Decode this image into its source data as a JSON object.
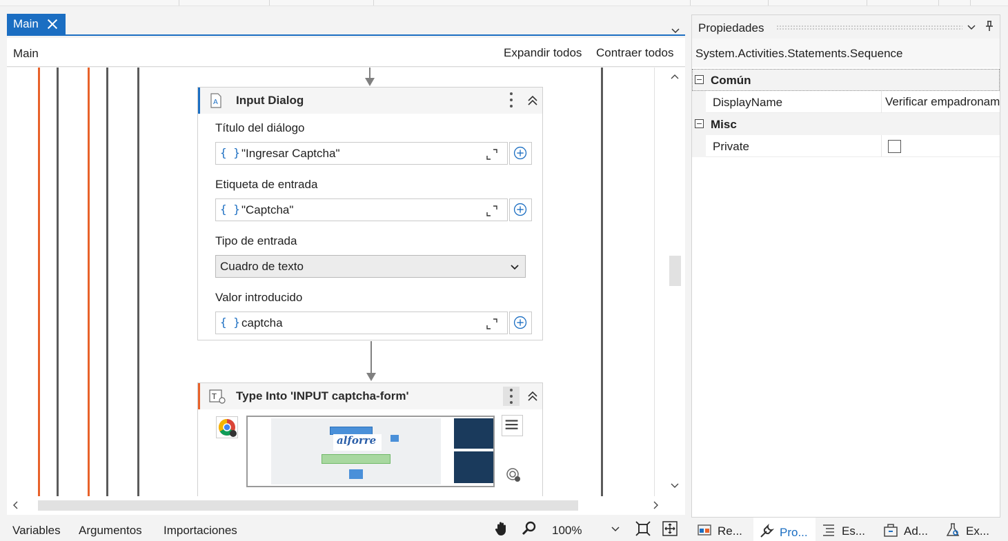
{
  "tab": {
    "title": "Main"
  },
  "breadcrumb": {
    "path": "Main",
    "expand_all": "Expandir todos",
    "collapse_all": "Contraer todos"
  },
  "input_dialog": {
    "title": "Input Dialog",
    "fields": [
      {
        "label": "Título del diálogo",
        "value": "\"Ingresar Captcha\""
      },
      {
        "label": "Etiqueta de entrada",
        "value": "\"Captcha\""
      },
      {
        "label": "Tipo de entrada",
        "value": "Cuadro de texto"
      },
      {
        "label": "Valor introducido",
        "value": "captcha"
      }
    ],
    "brace_glyph": "{ }"
  },
  "type_into": {
    "title": "Type Into 'INPUT captcha-form'",
    "thumb_text": "alforre"
  },
  "bottom": {
    "variables": "Variables",
    "arguments": "Argumentos",
    "imports": "Importaciones",
    "zoom": "100%"
  },
  "properties": {
    "title": "Propiedades",
    "type_name": "System.Activities.Statements.Sequence",
    "categories": [
      {
        "label": "Común",
        "props": [
          {
            "name": "DisplayName",
            "value": "Verificar empadronam"
          }
        ]
      },
      {
        "label": "Misc",
        "props": [
          {
            "name": "Private",
            "value": ""
          }
        ]
      }
    ]
  },
  "panel_tabs": [
    "Re...",
    "Pro...",
    "Es...",
    "Ad...",
    "Ex..."
  ],
  "colors": {
    "accent": "#1b6ec2",
    "orange": "#e8622a",
    "gray_line": "#5a5a5a"
  },
  "icons": [
    "close-icon",
    "chevron-down-icon",
    "text-input-icon",
    "kebab-icon",
    "collapse-up-icon",
    "expand-icon",
    "plus-icon",
    "chrome-icon",
    "hamburger-icon",
    "target-icon",
    "hand-icon",
    "zoom-icon",
    "fit-screen-icon",
    "fullscreen-icon",
    "wrench-icon",
    "pin-icon"
  ]
}
